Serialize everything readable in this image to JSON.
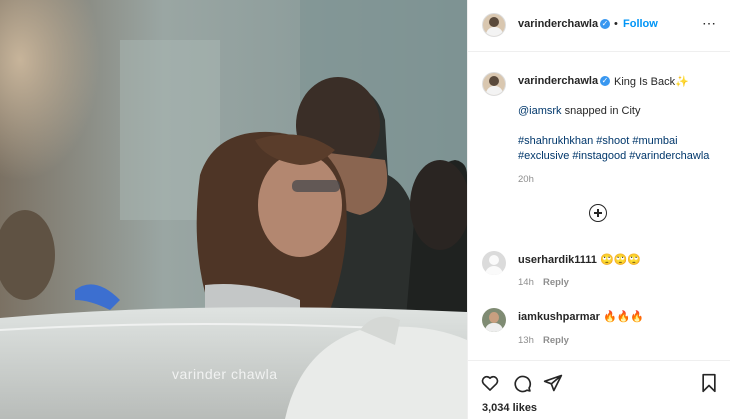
{
  "post": {
    "watermark": "varinder chawla"
  },
  "header": {
    "username": "varinderchawla",
    "separator": "•",
    "follow_label": "Follow",
    "more_label": "⋯"
  },
  "caption": {
    "username": "varinderchawla",
    "title": "King Is Back✨",
    "mention": "@iamsrk",
    "line2_rest": " snapped in City",
    "hashtags_line1": "#shahrukhkhan #shoot #mumbai",
    "hashtags_line2": "#exclusive #instagood #varinderchawla",
    "time": "20h"
  },
  "comments": [
    {
      "username": "userhardik1111",
      "text": "🙄🙄🙄",
      "time": "14h",
      "reply_label": "Reply"
    },
    {
      "username": "iamkushparmar",
      "text": "🔥🔥🔥",
      "time": "13h",
      "reply_label": "Reply"
    }
  ],
  "actions": {
    "likes": "3,034 likes",
    "icons": [
      "heart-icon",
      "comment-icon",
      "share-icon",
      "bookmark-icon",
      "load-more-icon"
    ]
  },
  "colors": {
    "accent": "#0095f6",
    "verified": "#3897f0",
    "text": "#262626",
    "muted": "#8e8e8e",
    "link": "#00376b"
  }
}
